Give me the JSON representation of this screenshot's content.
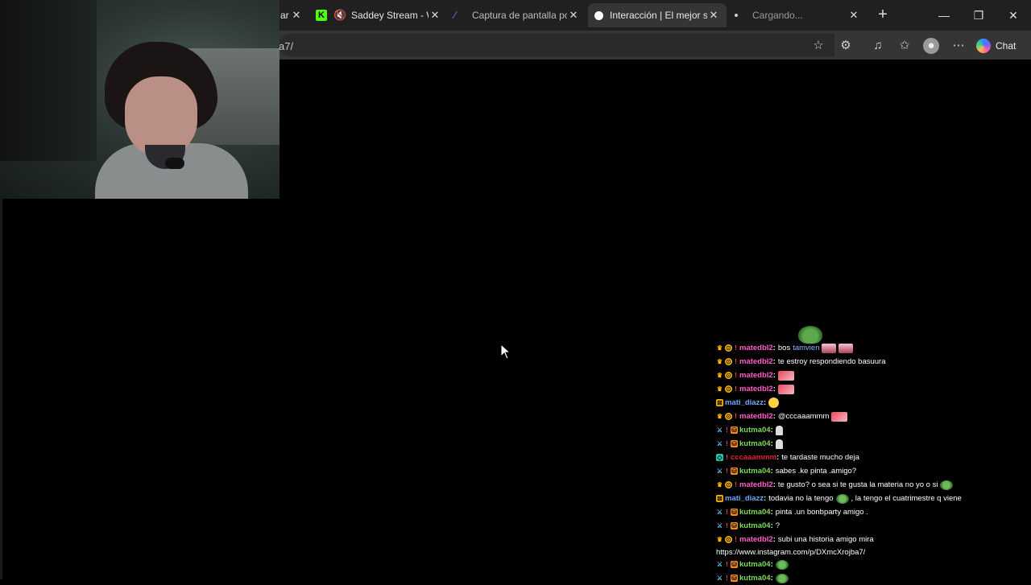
{
  "tabs": [
    {
      "title": "ar",
      "icon": "tab-partial",
      "active": false
    },
    {
      "title": "Saddey Stream - W",
      "icon": "kick-icon",
      "muted": true,
      "active": false
    },
    {
      "title": "Captura de pantalla por",
      "icon": "capture-icon",
      "active": false
    },
    {
      "title": "Interacción | El mejor so",
      "icon": "interaccion-icon",
      "active": true
    },
    {
      "title": "Cargando...",
      "icon": "loading-dot",
      "active": false
    }
  ],
  "address": {
    "url_fragment": "a7/"
  },
  "toolbar": {
    "chat_label": "Chat"
  },
  "chat": {
    "messages": [
      {
        "badges": [
          "crown",
          "coin",
          "bang"
        ],
        "user": "matedbl2",
        "color": "#ff5ec9",
        "text": "bos",
        "mention": "tamvien",
        "emotes": [
          "pink",
          "pink"
        ]
      },
      {
        "badges": [
          "crown",
          "coin",
          "bang"
        ],
        "user": "matedbl2",
        "color": "#ff5ec9",
        "text": "te estroy respondiendo basuura",
        "emotes": []
      },
      {
        "badges": [
          "crown",
          "coin",
          "bang"
        ],
        "user": "matedbl2",
        "color": "#ff5ec9",
        "text": "",
        "emotes": [
          "sticker"
        ]
      },
      {
        "badges": [
          "crown",
          "coin",
          "bang"
        ],
        "user": "matedbl2",
        "color": "#ff5ec9",
        "text": "",
        "emotes": [
          "sticker"
        ]
      },
      {
        "badges": [
          "mod"
        ],
        "user": "mati_diazz",
        "color": "#6fa8ff",
        "text": "",
        "emotes": [
          "smile"
        ]
      },
      {
        "badges": [
          "crown",
          "coin",
          "bang"
        ],
        "user": "matedbl2",
        "color": "#ff5ec9",
        "text": "@cccaaammm",
        "emotes": [
          "sticker"
        ]
      },
      {
        "badges": [
          "sword",
          "bang",
          "sub"
        ],
        "user": "kutma04",
        "color": "#7ed957",
        "text": "",
        "emotes": [
          "ghost"
        ]
      },
      {
        "badges": [
          "sword",
          "bang",
          "sub"
        ],
        "user": "kutma04",
        "color": "#7ed957",
        "text": "",
        "emotes": [
          "ghost"
        ]
      },
      {
        "badges": [
          "vip",
          "bang"
        ],
        "user": "cccaaammm",
        "color": "#e0242f",
        "text": "te tardaste mucho deja",
        "emotes": []
      },
      {
        "badges": [
          "sword",
          "bang",
          "sub"
        ],
        "user": "kutma04",
        "color": "#7ed957",
        "text": "sabes .ke pinta .amigo?",
        "emotes": []
      },
      {
        "badges": [
          "crown",
          "coin",
          "bang"
        ],
        "user": "matedbl2",
        "color": "#ff5ec9",
        "text": "te gusto? o sea si te gusta la materia no yo o si",
        "emotes": [
          "frog"
        ]
      },
      {
        "badges": [
          "mod"
        ],
        "user": "mati_diazz",
        "color": "#6fa8ff",
        "text": "todavia no la tengo",
        "text2": ", la tengo el cuatrimestre q viene",
        "emotes": [
          "frog"
        ]
      },
      {
        "badges": [
          "sword",
          "bang",
          "sub"
        ],
        "user": "kutma04",
        "color": "#7ed957",
        "text": "pinta .un bonbparty amigo .",
        "emotes": []
      },
      {
        "badges": [
          "sword",
          "bang",
          "sub"
        ],
        "user": "kutma04",
        "color": "#7ed957",
        "text": "?",
        "emotes": []
      },
      {
        "badges": [
          "crown",
          "coin",
          "bang"
        ],
        "user": "matedbl2",
        "color": "#ff5ec9",
        "text": "subi una historia amigo mira",
        "emotes": []
      },
      {
        "badges": [],
        "user": "",
        "color": "#ffffff",
        "text": "https://www.instagram.com/p/DXmcXrojba7/",
        "emotes": [],
        "continuation": true
      },
      {
        "badges": [
          "sword",
          "bang",
          "sub"
        ],
        "user": "kutma04",
        "color": "#7ed957",
        "text": "",
        "emotes": [
          "frog"
        ]
      },
      {
        "badges": [
          "sword",
          "bang",
          "sub"
        ],
        "user": "kutma04",
        "color": "#7ed957",
        "text": "",
        "emotes": [
          "frog"
        ]
      }
    ]
  }
}
